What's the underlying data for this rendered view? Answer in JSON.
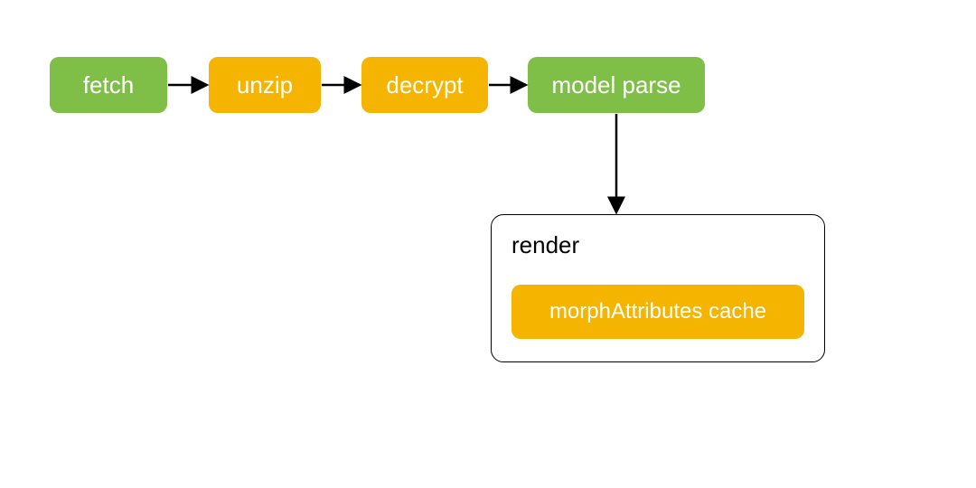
{
  "nodes": {
    "fetch": "fetch",
    "unzip": "unzip",
    "decrypt": "decrypt",
    "model_parse": "model parse",
    "render": "render",
    "morph_cache": "morphAttributes cache"
  },
  "colors": {
    "green": "#7fbf48",
    "orange": "#f5b400"
  },
  "chart_data": {
    "type": "flowchart",
    "title": "",
    "steps": [
      {
        "id": "fetch",
        "label": "fetch",
        "color": "green"
      },
      {
        "id": "unzip",
        "label": "unzip",
        "color": "orange"
      },
      {
        "id": "decrypt",
        "label": "decrypt",
        "color": "orange"
      },
      {
        "id": "model_parse",
        "label": "model parse",
        "color": "green"
      },
      {
        "id": "render",
        "label": "render",
        "color": "container",
        "contains": [
          {
            "id": "morph_cache",
            "label": "morphAttributes cache",
            "color": "orange"
          }
        ]
      }
    ],
    "edges": [
      [
        "fetch",
        "unzip"
      ],
      [
        "unzip",
        "decrypt"
      ],
      [
        "decrypt",
        "model_parse"
      ],
      [
        "model_parse",
        "render"
      ]
    ]
  }
}
